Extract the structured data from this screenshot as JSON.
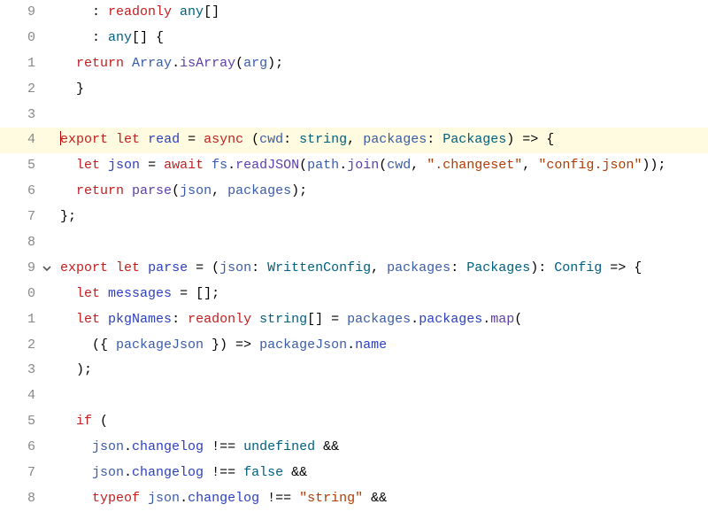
{
  "lines": [
    {
      "num": "9",
      "indent": "    ",
      "hl": false
    },
    {
      "num": "0",
      "indent": "    ",
      "hl": false
    },
    {
      "num": "1",
      "indent": "  ",
      "hl": false
    },
    {
      "num": "2",
      "indent": "  ",
      "hl": false
    },
    {
      "num": "3",
      "indent": "",
      "hl": false
    },
    {
      "num": "4",
      "indent": "",
      "hl": true
    },
    {
      "num": "5",
      "indent": "  ",
      "hl": false
    },
    {
      "num": "6",
      "indent": "  ",
      "hl": false
    },
    {
      "num": "7",
      "indent": "",
      "hl": false
    },
    {
      "num": "8",
      "indent": "",
      "hl": false
    },
    {
      "num": "9",
      "indent": "",
      "hl": false,
      "fold": true
    },
    {
      "num": "0",
      "indent": "  ",
      "hl": false
    },
    {
      "num": "1",
      "indent": "  ",
      "hl": false
    },
    {
      "num": "2",
      "indent": "    ",
      "hl": false
    },
    {
      "num": "3",
      "indent": "  ",
      "hl": false
    },
    {
      "num": "4",
      "indent": "",
      "hl": false
    },
    {
      "num": "5",
      "indent": "  ",
      "hl": false
    },
    {
      "num": "6",
      "indent": "    ",
      "hl": false
    },
    {
      "num": "7",
      "indent": "    ",
      "hl": false
    },
    {
      "num": "8",
      "indent": "    ",
      "hl": false
    }
  ],
  "tokens": {
    "readonly": "readonly",
    "any": "any",
    "arr": "[]",
    "obrace": " {",
    "return": "return",
    "Array": "Array",
    "isArray": "isArray",
    "arg": "arg",
    "cbrace": "}",
    "export": "export",
    "let": "let",
    "read": "read",
    "async": "async",
    "cwd": "cwd",
    "string": "string",
    "packages": "packages",
    "Packages": "Packages",
    "arrow": " => {",
    "json": "json",
    "await": "await",
    "fs": "fs",
    "readJSON": "readJSON",
    "path": "path",
    "join": "join",
    "s_changeset": "\".changeset\"",
    "s_config": "\"config.json\"",
    "parse": "parse",
    "WrittenConfig": "WrittenConfig",
    "Config": "Config",
    "messages": "messages",
    "empty_arr": " = [];",
    "pkgNames": "pkgNames",
    "packagesProp": "packages",
    "map": "map",
    "packageJson": "packageJson",
    "name": "name",
    "if": "if",
    "changelog": "changelog",
    "neq": " !== ",
    "undefined": "undefined",
    "false": "false",
    "typeof": "typeof",
    "s_string": "\"string\"",
    "amp": " &&"
  }
}
